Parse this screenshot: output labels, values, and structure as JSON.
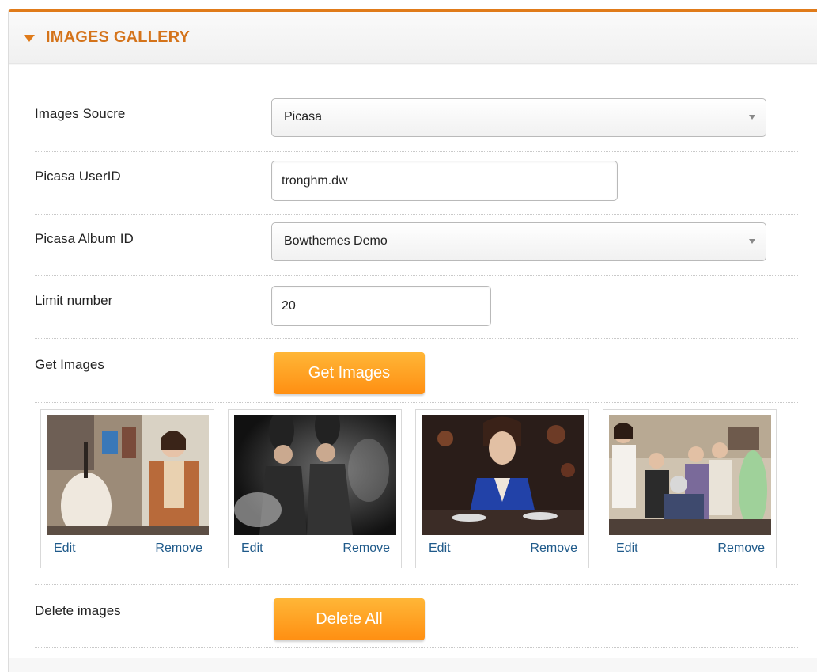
{
  "panel": {
    "title": "IMAGES GALLERY"
  },
  "form": {
    "images_source": {
      "label": "Images Soucre",
      "selected": "Picasa"
    },
    "picasa_userid": {
      "label": "Picasa UserID",
      "value": "tronghm.dw"
    },
    "picasa_album": {
      "label": "Picasa Album ID",
      "selected": "Bowthemes Demo"
    },
    "limit": {
      "label": "Limit number",
      "value": "20"
    },
    "get_images": {
      "label": "Get Images",
      "button": "Get Images"
    },
    "delete_images": {
      "label": "Delete images",
      "button": "Delete All"
    }
  },
  "gallery": {
    "items": [
      {
        "edit": "Edit",
        "remove": "Remove"
      },
      {
        "edit": "Edit",
        "remove": "Remove"
      },
      {
        "edit": "Edit",
        "remove": "Remove"
      },
      {
        "edit": "Edit",
        "remove": "Remove"
      }
    ]
  },
  "colors": {
    "accent": "#e07b1a",
    "button": "#ff9a1f",
    "link": "#1f5a8a"
  }
}
